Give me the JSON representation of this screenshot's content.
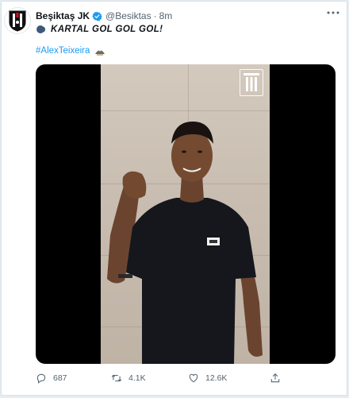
{
  "tweet": {
    "author_name": "Beşiktaş JK",
    "handle": "@Besiktas",
    "separator": "·",
    "time": "8m",
    "text": "KARTAL GOL GOL GOL!",
    "hashtag": "#AlexTeixeira",
    "speaker_icon": "speaking-head-icon",
    "hashtag_emoji": "eagle-emoji-icon"
  },
  "media": {
    "type": "video",
    "overlay_logo": "besiktas-crest-icon"
  },
  "actions": {
    "reply_count": "687",
    "retweet_count": "4.1K",
    "like_count": "12.6K"
  },
  "colors": {
    "link": "#1d9bf0",
    "verified": "#1d9bf0",
    "secondary_text": "#536471",
    "card_bg": "#ffffff",
    "page_bg": "#e6ecf0"
  }
}
